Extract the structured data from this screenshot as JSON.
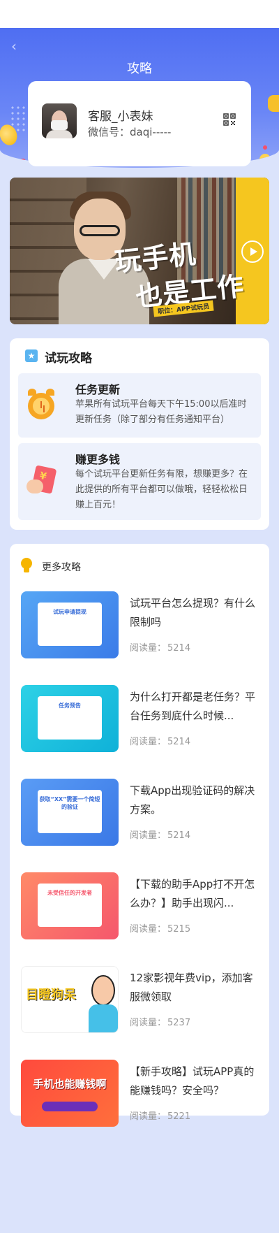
{
  "header": {
    "back_icon": "chevron-left-icon",
    "title": "攻略"
  },
  "service": {
    "name": "客服_小表妹",
    "wechat": "微信号：daqi-----",
    "qr_icon": "qr-code-icon"
  },
  "banner": {
    "slogan_line1": "玩手机",
    "slogan_line2": "也是工作",
    "tag": "职位：APP试玩员",
    "play_icon": "play-icon"
  },
  "guide": {
    "title": "试玩攻略",
    "items": [
      {
        "title": "任务更新",
        "desc": "苹果所有试玩平台每天下午15:00以后准时更新任务（除了部分有任务通知平台）",
        "icon": "alarm-clock-icon"
      },
      {
        "title": "赚更多钱",
        "desc": "每个试玩平台更新任务有限，想赚更多？在此提供的所有平台都可以做哦，轻轻松松日赚上百元！",
        "icon": "red-envelope-icon"
      }
    ]
  },
  "more": {
    "title": "更多攻略",
    "read_label": "阅读量：",
    "articles": [
      {
        "title": "试玩平台怎么提现？有什么限制吗",
        "reads": "5214",
        "thumb_text": "试玩申请提现"
      },
      {
        "title": "为什么打开都是老任务？平台任务到底什么时候...",
        "reads": "5214",
        "thumb_text": "任务预告"
      },
      {
        "title": "下载App出现验证码的解决方案。",
        "reads": "5214",
        "thumb_text": "获取“XX”需要一个简短的验证"
      },
      {
        "title": "【下载的助手App打不开怎么办？】助手出现闪...",
        "reads": "5215",
        "thumb_text": "未受信任的开发者"
      },
      {
        "title": "12家影视年费vip，添加客服微领取",
        "reads": "5237",
        "thumb_text": "目瞪狗呆"
      },
      {
        "title": "【新手攻略】试玩APP真的能赚钱吗？安全吗？",
        "reads": "5221",
        "thumb_text": "手机也能赚钱啊"
      }
    ]
  },
  "colors": {
    "hero": "#4f6ef2",
    "page_bg": "#dbe3fb",
    "accent_yellow": "#f5c61f"
  }
}
